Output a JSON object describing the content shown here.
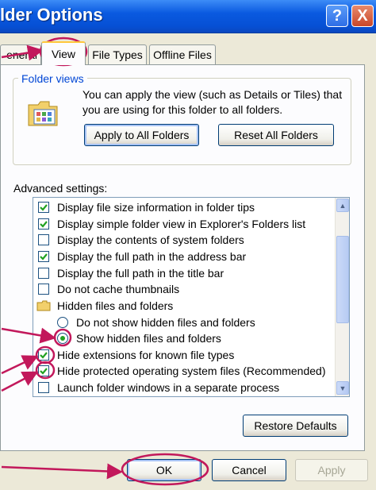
{
  "window": {
    "title": "lder Options",
    "help_glyph": "?",
    "close_glyph": "X"
  },
  "tabs": [
    {
      "label": "eneral"
    },
    {
      "label": "View",
      "active": true
    },
    {
      "label": "File Types"
    },
    {
      "label": "Offline Files"
    }
  ],
  "folder_views": {
    "group_label": "Folder views",
    "description": "You can apply the view (such as Details or Tiles) that you are using for this folder to all folders.",
    "apply_all_label": "Apply to All Folders",
    "reset_all_label": "Reset All Folders"
  },
  "advanced": {
    "label": "Advanced settings:",
    "items": [
      {
        "type": "checkbox",
        "checked": true,
        "label": "Display file size information in folder tips"
      },
      {
        "type": "checkbox",
        "checked": true,
        "label": "Display simple folder view in Explorer's Folders list"
      },
      {
        "type": "checkbox",
        "checked": false,
        "label": "Display the contents of system folders"
      },
      {
        "type": "checkbox",
        "checked": true,
        "label": "Display the full path in the address bar"
      },
      {
        "type": "checkbox",
        "checked": false,
        "label": "Display the full path in the title bar"
      },
      {
        "type": "checkbox",
        "checked": false,
        "label": "Do not cache thumbnails"
      },
      {
        "type": "folder",
        "label": "Hidden files and folders"
      },
      {
        "type": "radio",
        "selected": false,
        "label": "Do not show hidden files and folders"
      },
      {
        "type": "radio",
        "selected": true,
        "label": "Show hidden files and folders"
      },
      {
        "type": "checkbox",
        "checked": true,
        "label": "Hide extensions for known file types"
      },
      {
        "type": "checkbox",
        "checked": true,
        "label": "Hide protected operating system files (Recommended)"
      },
      {
        "type": "checkbox",
        "checked": false,
        "label": "Launch folder windows in a separate process"
      }
    ],
    "restore_defaults_label": "Restore Defaults"
  },
  "footer": {
    "ok_label": "OK",
    "cancel_label": "Cancel",
    "apply_label": "Apply"
  },
  "colors": {
    "annotation": "#c2185b",
    "check": "#21a121",
    "titlebar": "#0650d5"
  },
  "icons": {
    "help": "question-mark-icon",
    "close": "close-icon",
    "folder_views": "folder-views-icon",
    "hidden_folder": "folder-icon",
    "check": "checkmark-icon",
    "scroll_up": "chevron-up-icon",
    "scroll_down": "chevron-down-icon"
  }
}
